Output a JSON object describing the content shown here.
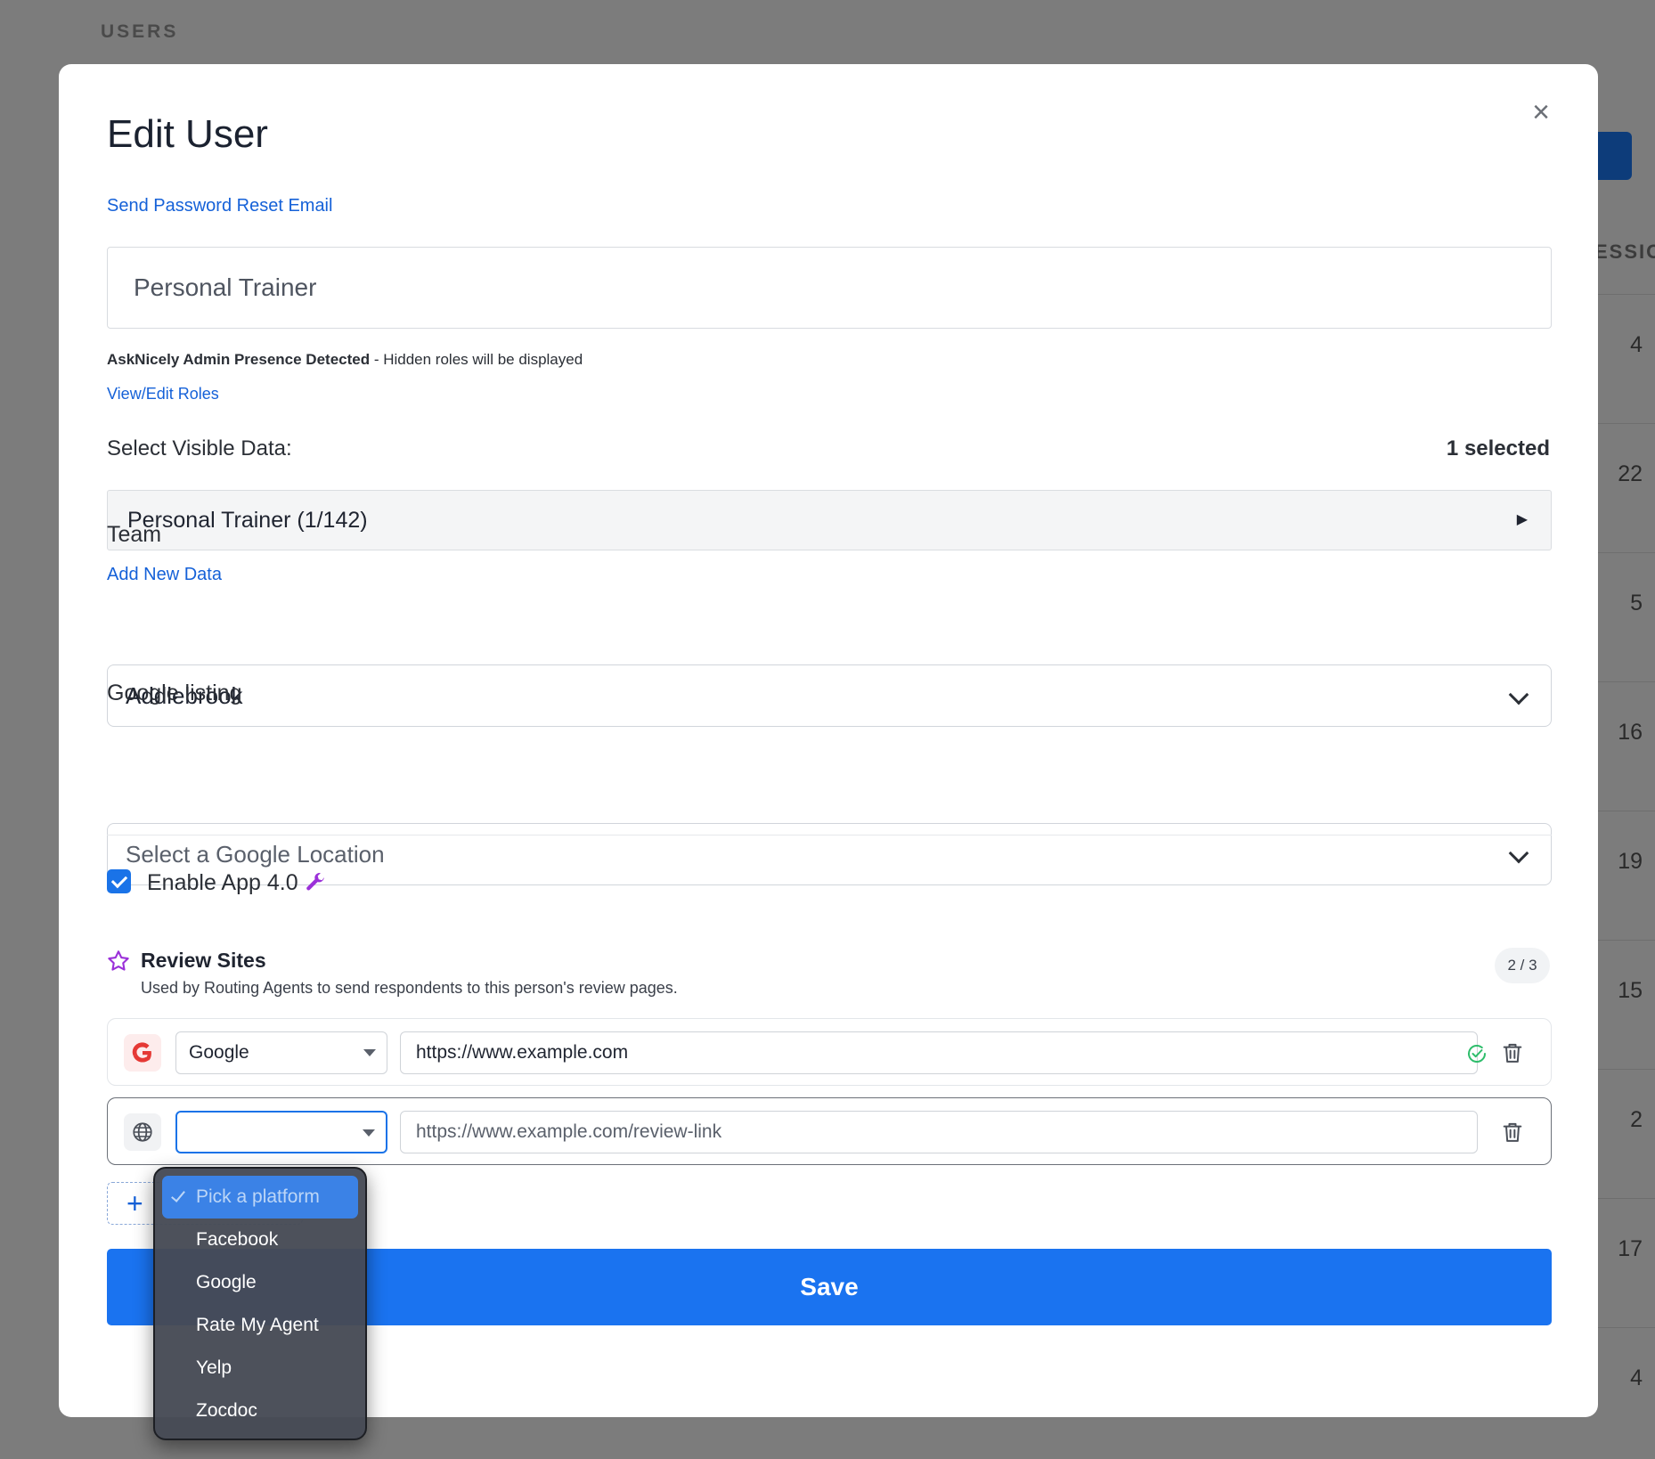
{
  "background": {
    "section_title": "USERS",
    "column_header": "ESSIO",
    "row_values": [
      "4",
      "22",
      "5",
      "16",
      "19",
      "15",
      "2",
      "17",
      "4"
    ]
  },
  "modal": {
    "title": "Edit User",
    "close_label": "×",
    "reset_link": "Send Password Reset Email",
    "name_value": "Personal Trainer",
    "admin_note_bold": "AskNicely Admin Presence Detected",
    "admin_note_rest": " - Hidden roles will be displayed",
    "roles_link": "View/Edit Roles",
    "visible_data": {
      "label": "Select Visible Data:",
      "selected_count": "1 selected",
      "row_label": "Personal Trainer (1/142)",
      "add_link": "Add New Data"
    },
    "team": {
      "label": "Team",
      "value": "Addlebrook"
    },
    "google_listing": {
      "label": "Google listing",
      "placeholder": "Select a Google Location"
    },
    "enable_app": {
      "label": "Enable App 4.0",
      "checked": true
    },
    "review_sites": {
      "title": "Review Sites",
      "description": "Used by Routing Agents to send respondents to this person's review pages.",
      "count": "2 / 3",
      "rows": [
        {
          "platform": "Google",
          "url": "https://www.example.com",
          "verified": true
        },
        {
          "platform": "",
          "url_placeholder": "https://www.example.com/review-link",
          "verified": false
        }
      ]
    },
    "save_label": "Save"
  },
  "dropdown": {
    "options": [
      "Pick a platform",
      "Facebook",
      "Google",
      "Rate My Agent",
      "Yelp",
      "Zocdoc"
    ],
    "selected_index": 0
  },
  "colors": {
    "accent": "#1a73f0",
    "link": "#1561d8",
    "brand_icon": "#9b30d9",
    "google_red": "#e53935",
    "ok_green": "#2ebd6b"
  }
}
